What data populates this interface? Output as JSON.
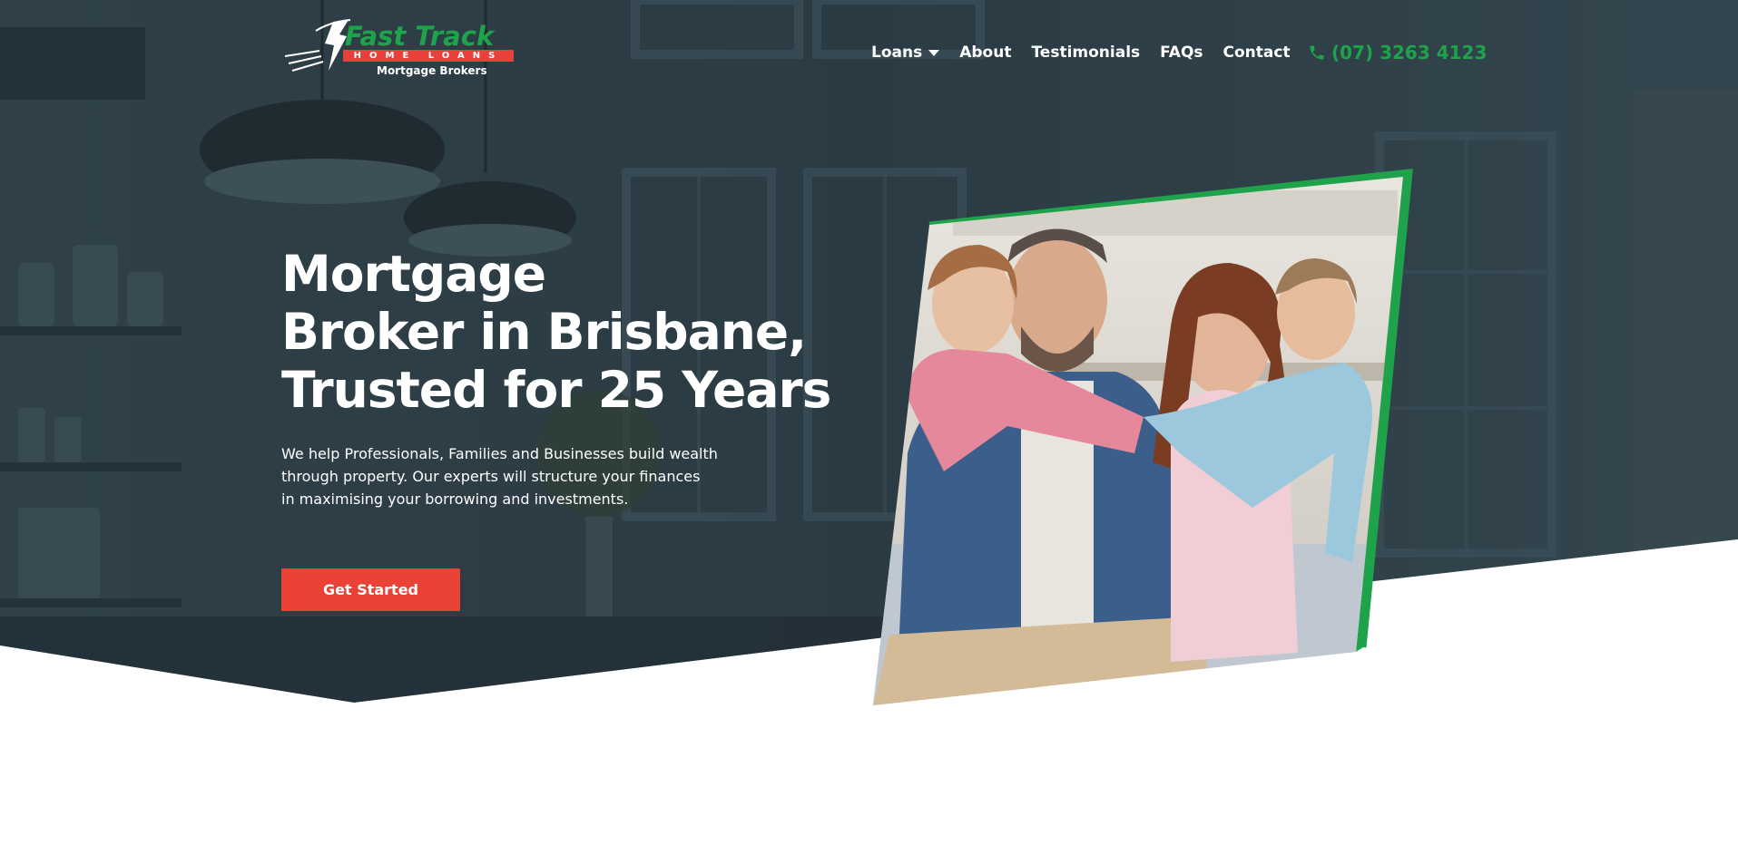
{
  "brand": {
    "script_name": "Fast Track",
    "strip": "HOME LOANS",
    "subtitle": "Mortgage Brokers"
  },
  "nav": {
    "items": [
      {
        "label": "Loans",
        "has_dropdown": true
      },
      {
        "label": "About"
      },
      {
        "label": "Testimonials"
      },
      {
        "label": "FAQs"
      },
      {
        "label": "Contact"
      }
    ],
    "phone": "(07) 3263 4123"
  },
  "hero": {
    "headline_lines": [
      "Mortgage",
      "Broker in Brisbane,",
      "Trusted for 25 Years"
    ],
    "lead_lines": [
      "We help Professionals, Families and Businesses build wealth",
      "through property. Our experts will structure your finances",
      "in maximising your borrowing and investments."
    ],
    "cta_label": "Get Started"
  },
  "colors": {
    "accent_green": "#1fa34a",
    "cta_red": "#ea4236",
    "hero_overlay": "#2a3a42"
  },
  "icons": {
    "phone": "phone-icon",
    "dropdown": "chevron-down-icon"
  }
}
